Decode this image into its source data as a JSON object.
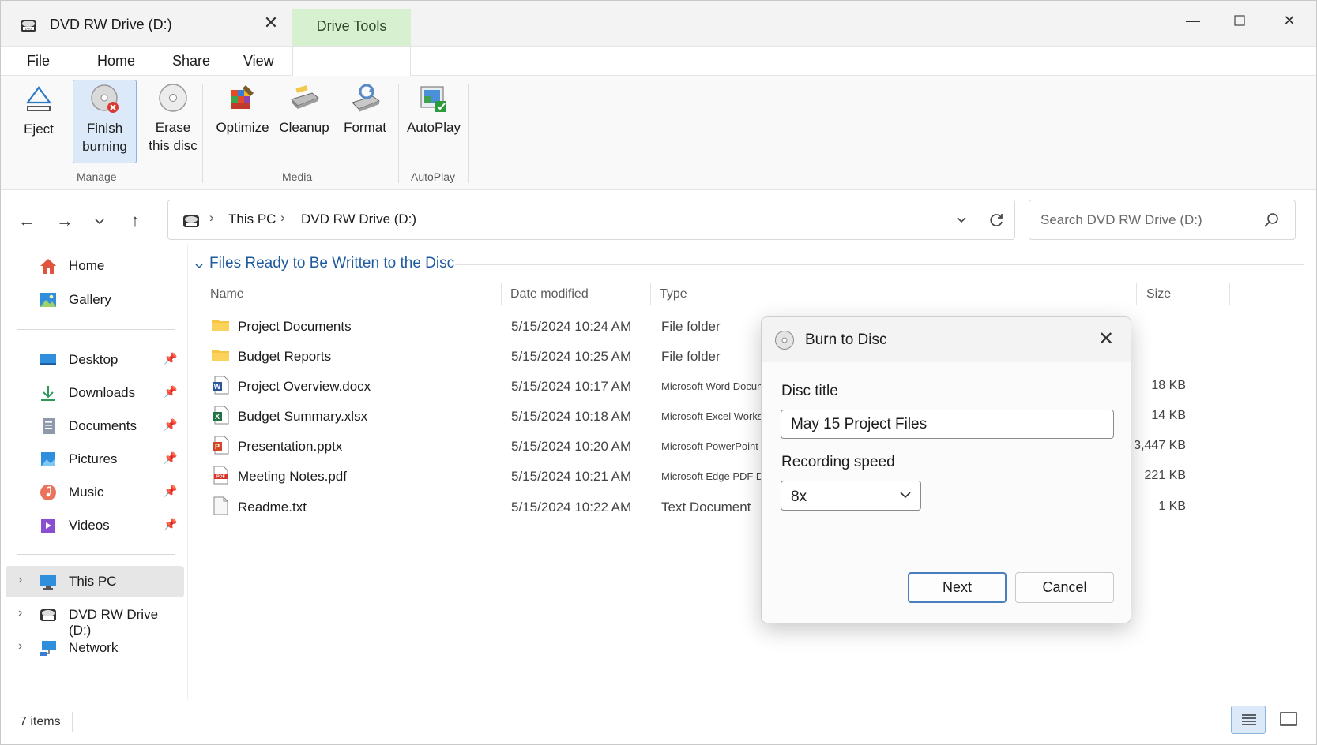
{
  "window": {
    "tab_title": "DVD RW Drive (D:)",
    "context_tab": "Drive Tools"
  },
  "menu": [
    "File",
    "Home",
    "Share",
    "View"
  ],
  "ribbon": {
    "eject": "Eject",
    "finish_burning_1": "Finish",
    "finish_burning_2": "burning",
    "erase_1": "Erase",
    "erase_2": "this disc",
    "optimize": "Optimize",
    "cleanup": "Cleanup",
    "format": "Format",
    "autoplay": "AutoPlay",
    "groups": {
      "manage": "Manage",
      "media": "Media",
      "autoplay": "AutoPlay"
    }
  },
  "address": {
    "crumbs": [
      "This PC",
      "DVD RW Drive (D:)"
    ],
    "search_placeholder": "Search DVD RW Drive (D:)"
  },
  "nav": {
    "home": "Home",
    "gallery": "Gallery",
    "desktop": "Desktop",
    "downloads": "Downloads",
    "documents": "Documents",
    "pictures": "Pictures",
    "music": "Music",
    "videos": "Videos",
    "this_pc": "This PC",
    "dvd": "DVD RW Drive (D:)",
    "network": "Network"
  },
  "content": {
    "group_header": "Files Ready to Be Written to the Disc",
    "columns": {
      "name": "Name",
      "date": "Date modified",
      "type": "Type",
      "size": "Size"
    },
    "files": [
      {
        "name": "Project Documents",
        "date": "5/15/2024 10:24 AM",
        "type": "File folder",
        "size": "",
        "icon": "folder-icon"
      },
      {
        "name": "Budget Reports",
        "date": "5/15/2024 10:25 AM",
        "type": "File folder",
        "size": "",
        "icon": "folder-icon"
      },
      {
        "name": "Project Overview.docx",
        "date": "5/15/2024 10:17 AM",
        "type": "Microsoft Word Document",
        "size": "18 KB",
        "icon": "word-icon"
      },
      {
        "name": "Budget Summary.xlsx",
        "date": "5/15/2024 10:18 AM",
        "type": "Microsoft Excel Worksheet",
        "size": "14 KB",
        "icon": "excel-icon"
      },
      {
        "name": "Presentation.pptx",
        "date": "5/15/2024 10:20 AM",
        "type": "Microsoft PowerPoint Presentation",
        "size": "3,447 KB",
        "icon": "powerpoint-icon"
      },
      {
        "name": "Meeting Notes.pdf",
        "date": "5/15/2024 10:21 AM",
        "type": "Microsoft Edge PDF Document",
        "size": "221 KB",
        "icon": "pdf-icon"
      },
      {
        "name": "Readme.txt",
        "date": "5/15/2024 10:22 AM",
        "type": "Text Document",
        "size": "1 KB",
        "icon": "text-file-icon"
      }
    ]
  },
  "status": {
    "items": "7 items"
  },
  "dialog": {
    "title": "Burn to Disc",
    "disc_title_label": "Disc title",
    "disc_title_value": "May 15 Project Files",
    "speed_label": "Recording speed",
    "speed_value": "8x",
    "next": "Next",
    "cancel": "Cancel"
  }
}
